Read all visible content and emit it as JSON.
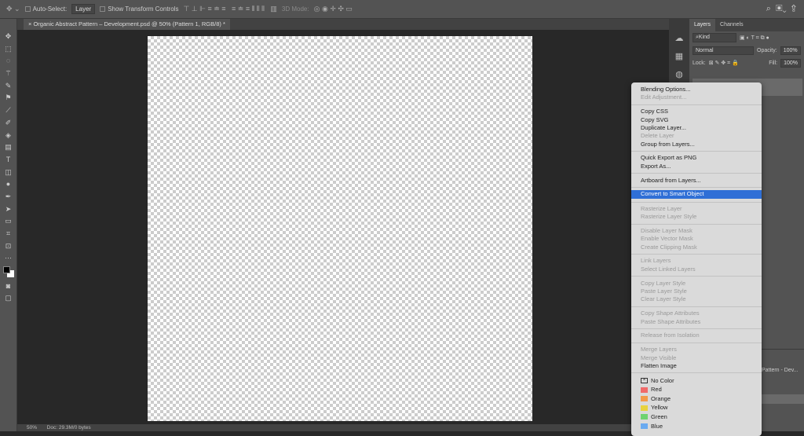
{
  "options_bar": {
    "auto_select_label": "Auto-Select:",
    "auto_select_value": "Layer",
    "transform_label": "Show Transform Controls",
    "mode_3d": "3D Mode:"
  },
  "document": {
    "tab_title": "Organic Abstract Pattern – Development.psd @ 50% (Pattern 1, RGB/8) *",
    "zoom": "50%",
    "doc_size": "Doc: 29.3M/0 bytes"
  },
  "layers_panel": {
    "tabs": [
      "Layers",
      "Channels"
    ],
    "filter": "Kind",
    "blend_mode": "Normal",
    "opacity_label": "Opacity:",
    "opacity": "100%",
    "lock_label": "Lock:",
    "fill_label": "Fill:",
    "fill": "100%",
    "layer_name_partial": "Pattern - Dev..."
  },
  "context_menu": {
    "groups": [
      [
        {
          "label": "Blending Options...",
          "enabled": true
        },
        {
          "label": "Edit Adjustment...",
          "enabled": false
        }
      ],
      [
        {
          "label": "Copy CSS",
          "enabled": true
        },
        {
          "label": "Copy SVG",
          "enabled": true
        },
        {
          "label": "Duplicate Layer...",
          "enabled": true
        },
        {
          "label": "Delete Layer",
          "enabled": false
        },
        {
          "label": "Group from Layers...",
          "enabled": true
        }
      ],
      [
        {
          "label": "Quick Export as PNG",
          "enabled": true
        },
        {
          "label": "Export As...",
          "enabled": true
        }
      ],
      [
        {
          "label": "Artboard from Layers...",
          "enabled": true
        }
      ],
      [
        {
          "label": "Convert to Smart Object",
          "enabled": true,
          "highlighted": true
        }
      ],
      [
        {
          "label": "Rasterize Layer",
          "enabled": false
        },
        {
          "label": "Rasterize Layer Style",
          "enabled": false
        }
      ],
      [
        {
          "label": "Disable Layer Mask",
          "enabled": false
        },
        {
          "label": "Enable Vector Mask",
          "enabled": false
        },
        {
          "label": "Create Clipping Mask",
          "enabled": false
        }
      ],
      [
        {
          "label": "Link Layers",
          "enabled": false
        },
        {
          "label": "Select Linked Layers",
          "enabled": false
        }
      ],
      [
        {
          "label": "Copy Layer Style",
          "enabled": false
        },
        {
          "label": "Paste Layer Style",
          "enabled": false
        },
        {
          "label": "Clear Layer Style",
          "enabled": false
        }
      ],
      [
        {
          "label": "Copy Shape Attributes",
          "enabled": false
        },
        {
          "label": "Paste Shape Attributes",
          "enabled": false
        }
      ],
      [
        {
          "label": "Release from Isolation",
          "enabled": false
        }
      ],
      [
        {
          "label": "Merge Layers",
          "enabled": false
        },
        {
          "label": "Merge Visible",
          "enabled": false
        },
        {
          "label": "Flatten Image",
          "enabled": true
        }
      ]
    ],
    "colors": [
      {
        "label": "No Color",
        "color": "none"
      },
      {
        "label": "Red",
        "color": "#f06a6a"
      },
      {
        "label": "Orange",
        "color": "#f29a4a"
      },
      {
        "label": "Yellow",
        "color": "#e8d23e"
      },
      {
        "label": "Green",
        "color": "#6fd36f"
      },
      {
        "label": "Blue",
        "color": "#6aaaf0"
      }
    ]
  }
}
